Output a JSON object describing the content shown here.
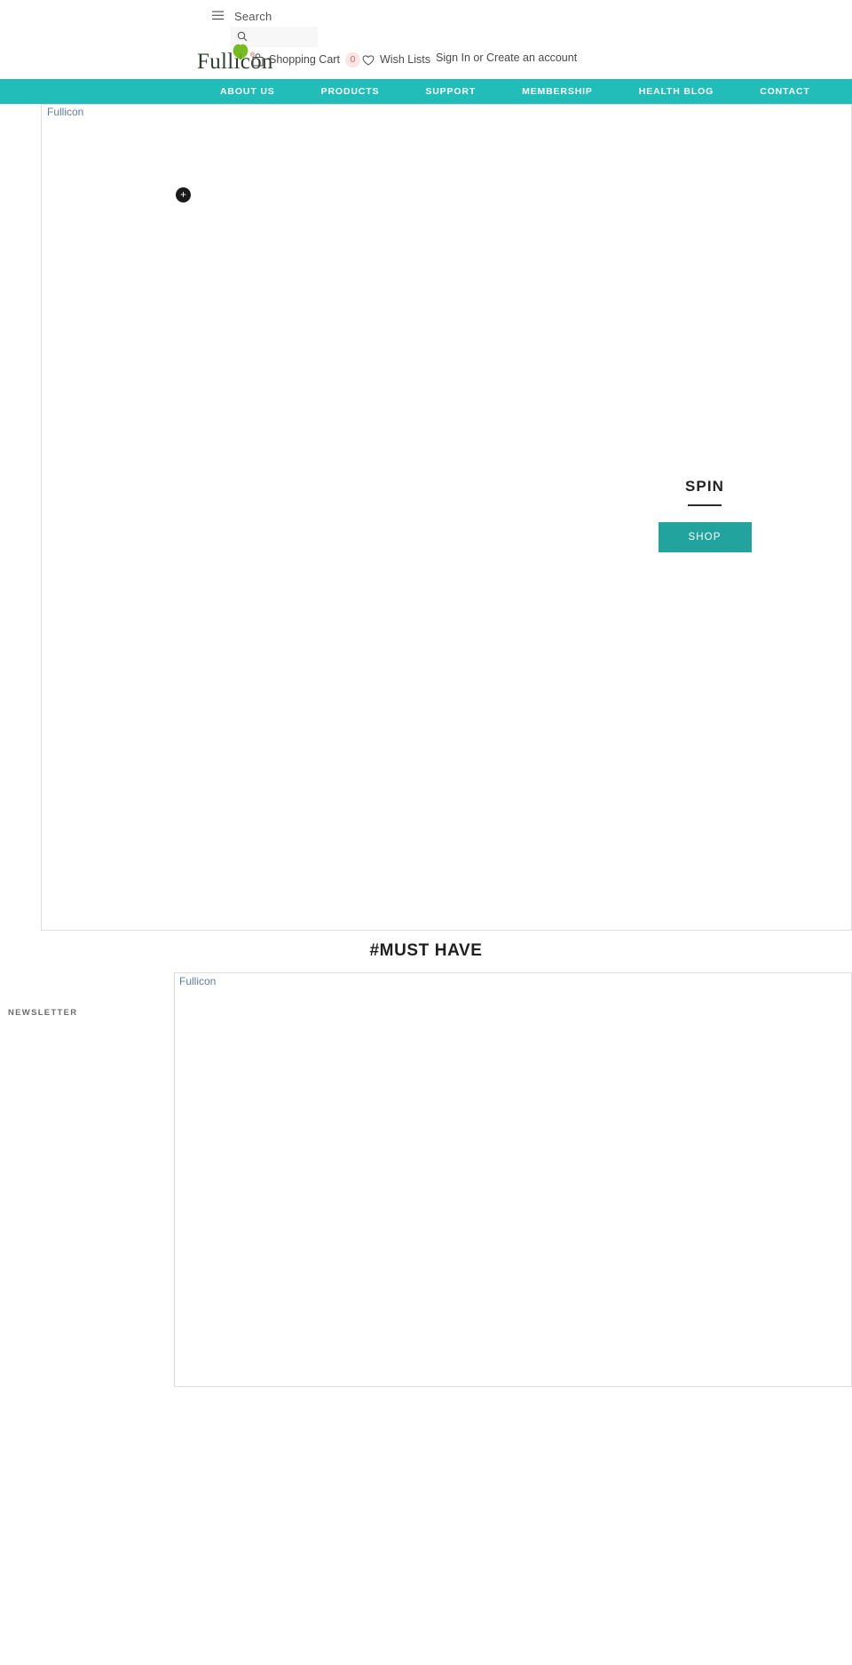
{
  "topbar": {
    "menu_icon": "hamburger-icon",
    "search_label": "Search",
    "search_placeholder": "",
    "search_value": "",
    "search_icon": "magnifier-icon"
  },
  "logo": {
    "text": "Fullicon",
    "registered_mark": "®",
    "leaf_icon": "ginkgo-leaf-icon",
    "leaf_color": "#76bc21"
  },
  "cart": {
    "icon": "shopping-bag-icon",
    "label": "Shopping Cart",
    "count": "0",
    "count_bg": "#fbe5e5",
    "count_color": "#c06a6a"
  },
  "wishlist": {
    "icon": "heart-icon",
    "label": "Wish Lists"
  },
  "account": {
    "sign_in": "Sign In",
    "separator": "or",
    "create_account": "Create an account"
  },
  "nav": {
    "background": "#22bdb9",
    "items": [
      {
        "label": "ABOUT US"
      },
      {
        "label": "PRODUCTS"
      },
      {
        "label": "SUPPORT"
      },
      {
        "label": "MEMBERSHIP"
      },
      {
        "label": "HEALTH BLOG"
      },
      {
        "label": "CONTACT"
      }
    ]
  },
  "hero": {
    "broken_image_alt": "Fullicon",
    "hotspot_label": "+",
    "title": "SPIN",
    "button_label": "SHOP",
    "button_color": "#22a39e"
  },
  "section": {
    "heading": "#MUST HAVE"
  },
  "panel": {
    "broken_image_alt": "Fullicon"
  },
  "newsletter": {
    "title": "NEWSLETTER"
  }
}
